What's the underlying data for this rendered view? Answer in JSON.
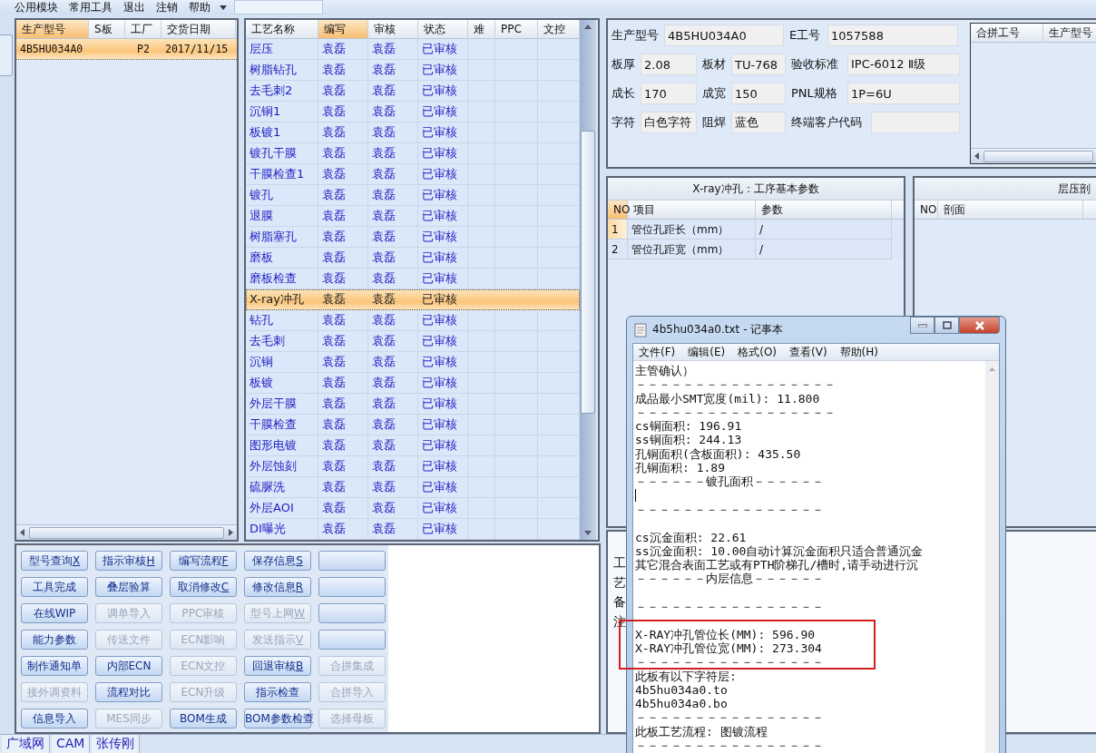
{
  "menu_bar": {
    "items": [
      "公用模块",
      "常用工具",
      "退出",
      "注销",
      "帮助"
    ]
  },
  "products": {
    "columns": [
      {
        "label": "生产型号",
        "highlighted": true
      },
      {
        "label": "S板",
        "highlighted": false
      },
      {
        "label": "工厂",
        "highlighted": false
      },
      {
        "label": "交货日期",
        "highlighted": false
      }
    ],
    "rows": [
      {
        "model": "4B5HU034A0",
        "factory": "P2",
        "date": "2017/11/15",
        "selected": true
      }
    ]
  },
  "processes": {
    "columns": [
      {
        "label": "工艺名称",
        "highlighted": false
      },
      {
        "label": "编写",
        "highlighted": true
      },
      {
        "label": "审核",
        "highlighted": false
      },
      {
        "label": "状态",
        "highlighted": false
      },
      {
        "label": "难",
        "highlighted": false
      },
      {
        "label": "PPC",
        "highlighted": false
      },
      {
        "label": "文控",
        "highlighted": false
      }
    ],
    "rows": [
      {
        "name": "层压",
        "writer": "袁磊",
        "reviewer": "袁磊",
        "status": "已审核",
        "selected": false
      },
      {
        "name": "树脂钻孔",
        "writer": "袁磊",
        "reviewer": "袁磊",
        "status": "已审核",
        "selected": false
      },
      {
        "name": "去毛刺2",
        "writer": "袁磊",
        "reviewer": "袁磊",
        "status": "已审核",
        "selected": false
      },
      {
        "name": "沉铜1",
        "writer": "袁磊",
        "reviewer": "袁磊",
        "status": "已审核",
        "selected": false
      },
      {
        "name": "板镀1",
        "writer": "袁磊",
        "reviewer": "袁磊",
        "status": "已审核",
        "selected": false
      },
      {
        "name": "镀孔干膜",
        "writer": "袁磊",
        "reviewer": "袁磊",
        "status": "已审核",
        "selected": false
      },
      {
        "name": "干膜检查1",
        "writer": "袁磊",
        "reviewer": "袁磊",
        "status": "已审核",
        "selected": false
      },
      {
        "name": "镀孔",
        "writer": "袁磊",
        "reviewer": "袁磊",
        "status": "已审核",
        "selected": false
      },
      {
        "name": "退膜",
        "writer": "袁磊",
        "reviewer": "袁磊",
        "status": "已审核",
        "selected": false
      },
      {
        "name": "树脂塞孔",
        "writer": "袁磊",
        "reviewer": "袁磊",
        "status": "已审核",
        "selected": false
      },
      {
        "name": "磨板",
        "writer": "袁磊",
        "reviewer": "袁磊",
        "status": "已审核",
        "selected": false
      },
      {
        "name": "磨板检查",
        "writer": "袁磊",
        "reviewer": "袁磊",
        "status": "已审核",
        "selected": false
      },
      {
        "name": "X-ray冲孔",
        "writer": "袁磊",
        "reviewer": "袁磊",
        "status": "已审核",
        "selected": true
      },
      {
        "name": "钻孔",
        "writer": "袁磊",
        "reviewer": "袁磊",
        "status": "已审核",
        "selected": false
      },
      {
        "name": "去毛刺",
        "writer": "袁磊",
        "reviewer": "袁磊",
        "status": "已审核",
        "selected": false
      },
      {
        "name": "沉铜",
        "writer": "袁磊",
        "reviewer": "袁磊",
        "status": "已审核",
        "selected": false
      },
      {
        "name": "板镀",
        "writer": "袁磊",
        "reviewer": "袁磊",
        "status": "已审核",
        "selected": false
      },
      {
        "name": "外层干膜",
        "writer": "袁磊",
        "reviewer": "袁磊",
        "status": "已审核",
        "selected": false
      },
      {
        "name": "干膜检查",
        "writer": "袁磊",
        "reviewer": "袁磊",
        "status": "已审核",
        "selected": false
      },
      {
        "name": "图形电镀",
        "writer": "袁磊",
        "reviewer": "袁磊",
        "status": "已审核",
        "selected": false
      },
      {
        "name": "外层蚀刻",
        "writer": "袁磊",
        "reviewer": "袁磊",
        "status": "已审核",
        "selected": false
      },
      {
        "name": "硫脲洗",
        "writer": "袁磊",
        "reviewer": "袁磊",
        "status": "已审核",
        "selected": false
      },
      {
        "name": "外层AOI",
        "writer": "袁磊",
        "reviewer": "袁磊",
        "status": "已审核",
        "selected": false
      },
      {
        "name": "DI曝光",
        "writer": "袁磊",
        "reviewer": "袁磊",
        "status": "已审核",
        "selected": false
      }
    ]
  },
  "buttons": [
    {
      "kind": "labeled",
      "label": "型号查询",
      "shortcut": "X",
      "disabled": false
    },
    {
      "kind": "labeled",
      "label": "指示审核",
      "shortcut": "H",
      "disabled": false
    },
    {
      "kind": "labeled",
      "label": "编写流程",
      "shortcut": "F",
      "disabled": false
    },
    {
      "kind": "labeled",
      "label": "保存信息",
      "shortcut": "S",
      "disabled": false
    },
    {
      "kind": "blank",
      "disabled": false
    },
    {
      "kind": "labeled",
      "label": "工具完成",
      "disabled": false
    },
    {
      "kind": "labeled",
      "label": "叠层验算",
      "disabled": false
    },
    {
      "kind": "labeled",
      "label": "取消修改",
      "shortcut": "C",
      "disabled": false
    },
    {
      "kind": "labeled",
      "label": "修改信息",
      "shortcut": "R",
      "disabled": false
    },
    {
      "kind": "blank",
      "disabled": false
    },
    {
      "kind": "labeled",
      "label": "在线WIP",
      "disabled": false
    },
    {
      "kind": "labeled",
      "label": "调单导入",
      "disabled": true
    },
    {
      "kind": "labeled",
      "label": "PPC审核",
      "disabled": true
    },
    {
      "kind": "labeled",
      "label": "型号上网",
      "shortcut": "W",
      "disabled": true
    },
    {
      "kind": "blank",
      "disabled": false
    },
    {
      "kind": "labeled",
      "label": "能力参数",
      "disabled": false
    },
    {
      "kind": "labeled",
      "label": "传送文件",
      "disabled": true
    },
    {
      "kind": "labeled",
      "label": "ECN影响",
      "disabled": true
    },
    {
      "kind": "labeled",
      "label": "发送指示",
      "shortcut": "V",
      "disabled": true
    },
    {
      "kind": "blank",
      "disabled": false
    },
    {
      "kind": "labeled",
      "label": "制作通知单",
      "disabled": false
    },
    {
      "kind": "labeled",
      "label": "内部ECN",
      "disabled": false
    },
    {
      "kind": "labeled",
      "label": "ECN文控",
      "disabled": true
    },
    {
      "kind": "labeled",
      "label": "回退审核",
      "shortcut": "B",
      "disabled": false
    },
    {
      "kind": "labeled",
      "label": "合拼集成",
      "disabled": true
    },
    {
      "kind": "labeled",
      "label": "接外调资料",
      "disabled": true
    },
    {
      "kind": "labeled",
      "label": "流程对比",
      "disabled": false
    },
    {
      "kind": "labeled",
      "label": "ECN升级",
      "disabled": true
    },
    {
      "kind": "labeled",
      "label": "指示检查",
      "disabled": false
    },
    {
      "kind": "labeled",
      "label": "合拼导入",
      "disabled": true
    },
    {
      "kind": "labeled",
      "label": "信息导入",
      "disabled": false
    },
    {
      "kind": "labeled",
      "label": "MES同步",
      "disabled": true
    },
    {
      "kind": "labeled",
      "label": "BOM生成",
      "disabled": false
    },
    {
      "kind": "labeled",
      "label": "BOM参数检查",
      "disabled": false
    },
    {
      "kind": "labeled",
      "label": "选择母板",
      "disabled": true
    }
  ],
  "form": {
    "fields": [
      {
        "label": "生产型号",
        "value": "4B5HU034A0"
      },
      {
        "label": "E工号",
        "value": "1057588"
      },
      {
        "label": "板厚",
        "value": "2.08"
      },
      {
        "label": "板材",
        "value": "TU-768"
      },
      {
        "label": "验收标准",
        "value": "IPC-6012 Ⅱ级"
      },
      {
        "label": "成长",
        "value": "170"
      },
      {
        "label": "成宽",
        "value": "150"
      },
      {
        "label": "PNL规格",
        "value": "1P=6U"
      },
      {
        "label": "字符",
        "value": "白色字符"
      },
      {
        "label": "阻焊",
        "value": "蓝色"
      },
      {
        "label": "终端客户代码"
      }
    ]
  },
  "merge_table": {
    "columns": [
      "合拼工号",
      "生产型号"
    ]
  },
  "params": {
    "title": "X-ray冲孔：工序基本参数",
    "columns": [
      {
        "label": "NO",
        "highlighted": true
      },
      {
        "label": "项目",
        "highlighted": false
      },
      {
        "label": "参数",
        "highlighted": false
      }
    ],
    "rows": [
      {
        "no": "1",
        "item": "管位孔距长（mm）",
        "value": "/",
        "selected": true
      },
      {
        "no": "2",
        "item": "管位孔距宽（mm）",
        "value": "/",
        "selected": false
      }
    ]
  },
  "lamination": {
    "title": "层压剖",
    "columns": [
      "NO",
      "剖面"
    ]
  },
  "remarks": {
    "label": "工艺备注"
  },
  "notepad": {
    "title": "4b5hu034a0.txt - 记事本",
    "menu": [
      "文件(F)",
      "编辑(E)",
      "格式(O)",
      "查看(V)",
      "帮助(H)"
    ],
    "highlight_box": true,
    "lines": [
      {
        "kind": "text",
        "text": "主管确认）"
      },
      {
        "kind": "text",
        "text": "－－－－－－－－－－－－－－－－－"
      },
      {
        "kind": "text",
        "text": "成品最小SMT宽度(mil): 11.800"
      },
      {
        "kind": "text",
        "text": "－－－－－－－－－－－－－－－－－"
      },
      {
        "kind": "text",
        "text": "cs铜面积: 196.91"
      },
      {
        "kind": "text",
        "text": "ss铜面积: 244.13"
      },
      {
        "kind": "text",
        "text": "孔铜面积(含板面积): 435.50"
      },
      {
        "kind": "text",
        "text": "孔铜面积: 1.89"
      },
      {
        "kind": "text",
        "text": "－－－－－－镀孔面积－－－－－－"
      },
      {
        "kind": "caret"
      },
      {
        "kind": "text",
        "text": "－－－－－－－－－－－－－－－－"
      },
      {
        "kind": "blank"
      },
      {
        "kind": "text",
        "text": "cs沉金面积: 22.61"
      },
      {
        "kind": "text",
        "text": "ss沉金面积: 10.00自动计算沉金面积只适合普通沉金"
      },
      {
        "kind": "text",
        "text": "其它混合表面工艺或有PTH阶梯孔/槽时,请手动进行沉"
      },
      {
        "kind": "text",
        "text": "－－－－－－内层信息－－－－－－"
      },
      {
        "kind": "blank"
      },
      {
        "kind": "text",
        "text": "－－－－－－－－－－－－－－－－"
      },
      {
        "kind": "blank"
      },
      {
        "kind": "text",
        "text": "X-RAY冲孔管位长(MM): 596.90"
      },
      {
        "kind": "text",
        "text": "X-RAY冲孔管位宽(MM): 273.304"
      },
      {
        "kind": "text",
        "text": "－－－－－－－－－－－－－－－－"
      },
      {
        "kind": "text",
        "text": "此板有以下字符层:"
      },
      {
        "kind": "text",
        "text": "4b5hu034a0.to"
      },
      {
        "kind": "text",
        "text": "4b5hu034a0.bo"
      },
      {
        "kind": "text",
        "text": "－－－－－－－－－－－－－－－－"
      },
      {
        "kind": "text",
        "text": "此板工艺流程: 图镀流程"
      },
      {
        "kind": "text",
        "text": "－－－－－－－－－－－－－－－－"
      }
    ]
  },
  "status_bar": {
    "tabs": [
      "广域网",
      "CAM",
      "张传刚"
    ]
  }
}
